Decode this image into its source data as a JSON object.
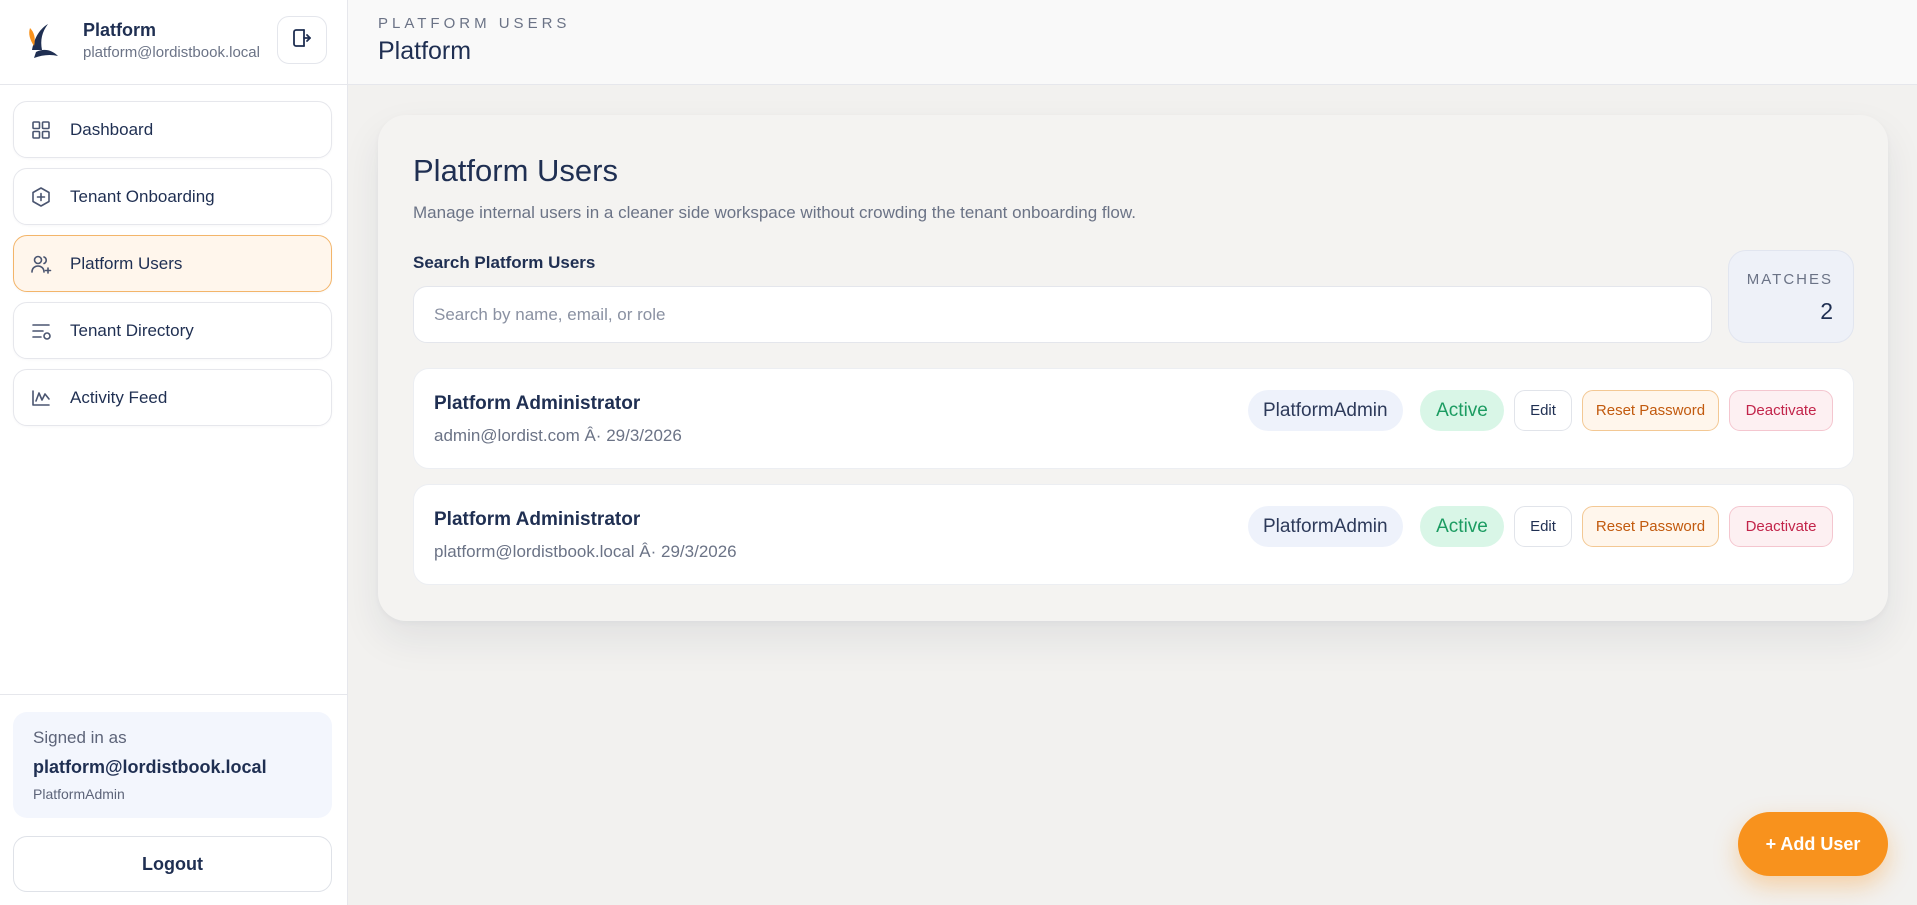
{
  "brand": {
    "title": "Platform",
    "subtitle": "platform@lordistbook.local"
  },
  "sidebar": {
    "items": [
      {
        "label": "Dashboard",
        "icon": "grid-icon",
        "active": false
      },
      {
        "label": "Tenant Onboarding",
        "icon": "hexagon-plus-icon",
        "active": false
      },
      {
        "label": "Platform Users",
        "icon": "users-plus-icon",
        "active": true
      },
      {
        "label": "Tenant Directory",
        "icon": "list-filter-icon",
        "active": false
      },
      {
        "label": "Activity Feed",
        "icon": "activity-wave-icon",
        "active": false
      }
    ],
    "signed_in": {
      "label": "Signed in as",
      "email": "platform@lordistbook.local",
      "role": "PlatformAdmin"
    },
    "logout_label": "Logout"
  },
  "header": {
    "eyebrow": "PLATFORM USERS",
    "title": "Platform"
  },
  "main": {
    "title": "Platform Users",
    "description": "Manage internal users in a cleaner side workspace without crowding the tenant onboarding flow.",
    "search": {
      "label": "Search Platform Users",
      "placeholder": "Search by name, email, or role",
      "value": ""
    },
    "matches": {
      "label": "MATCHES",
      "value": "2"
    },
    "users": [
      {
        "name": "Platform Administrator",
        "meta": "admin@lordist.com Â· 29/3/2026",
        "role": "PlatformAdmin",
        "status": "Active",
        "edit_label": "Edit",
        "reset_label": "Reset Password",
        "deactivate_label": "Deactivate"
      },
      {
        "name": "Platform Administrator",
        "meta": "platform@lordistbook.local Â· 29/3/2026",
        "role": "PlatformAdmin",
        "status": "Active",
        "edit_label": "Edit",
        "reset_label": "Reset Password",
        "deactivate_label": "Deactivate"
      }
    ],
    "add_user_label": "+ Add User"
  },
  "colors": {
    "accent": "#f8921d",
    "navy": "#1f2f52",
    "active_green": "#1c9c62",
    "danger": "#c2244a"
  }
}
